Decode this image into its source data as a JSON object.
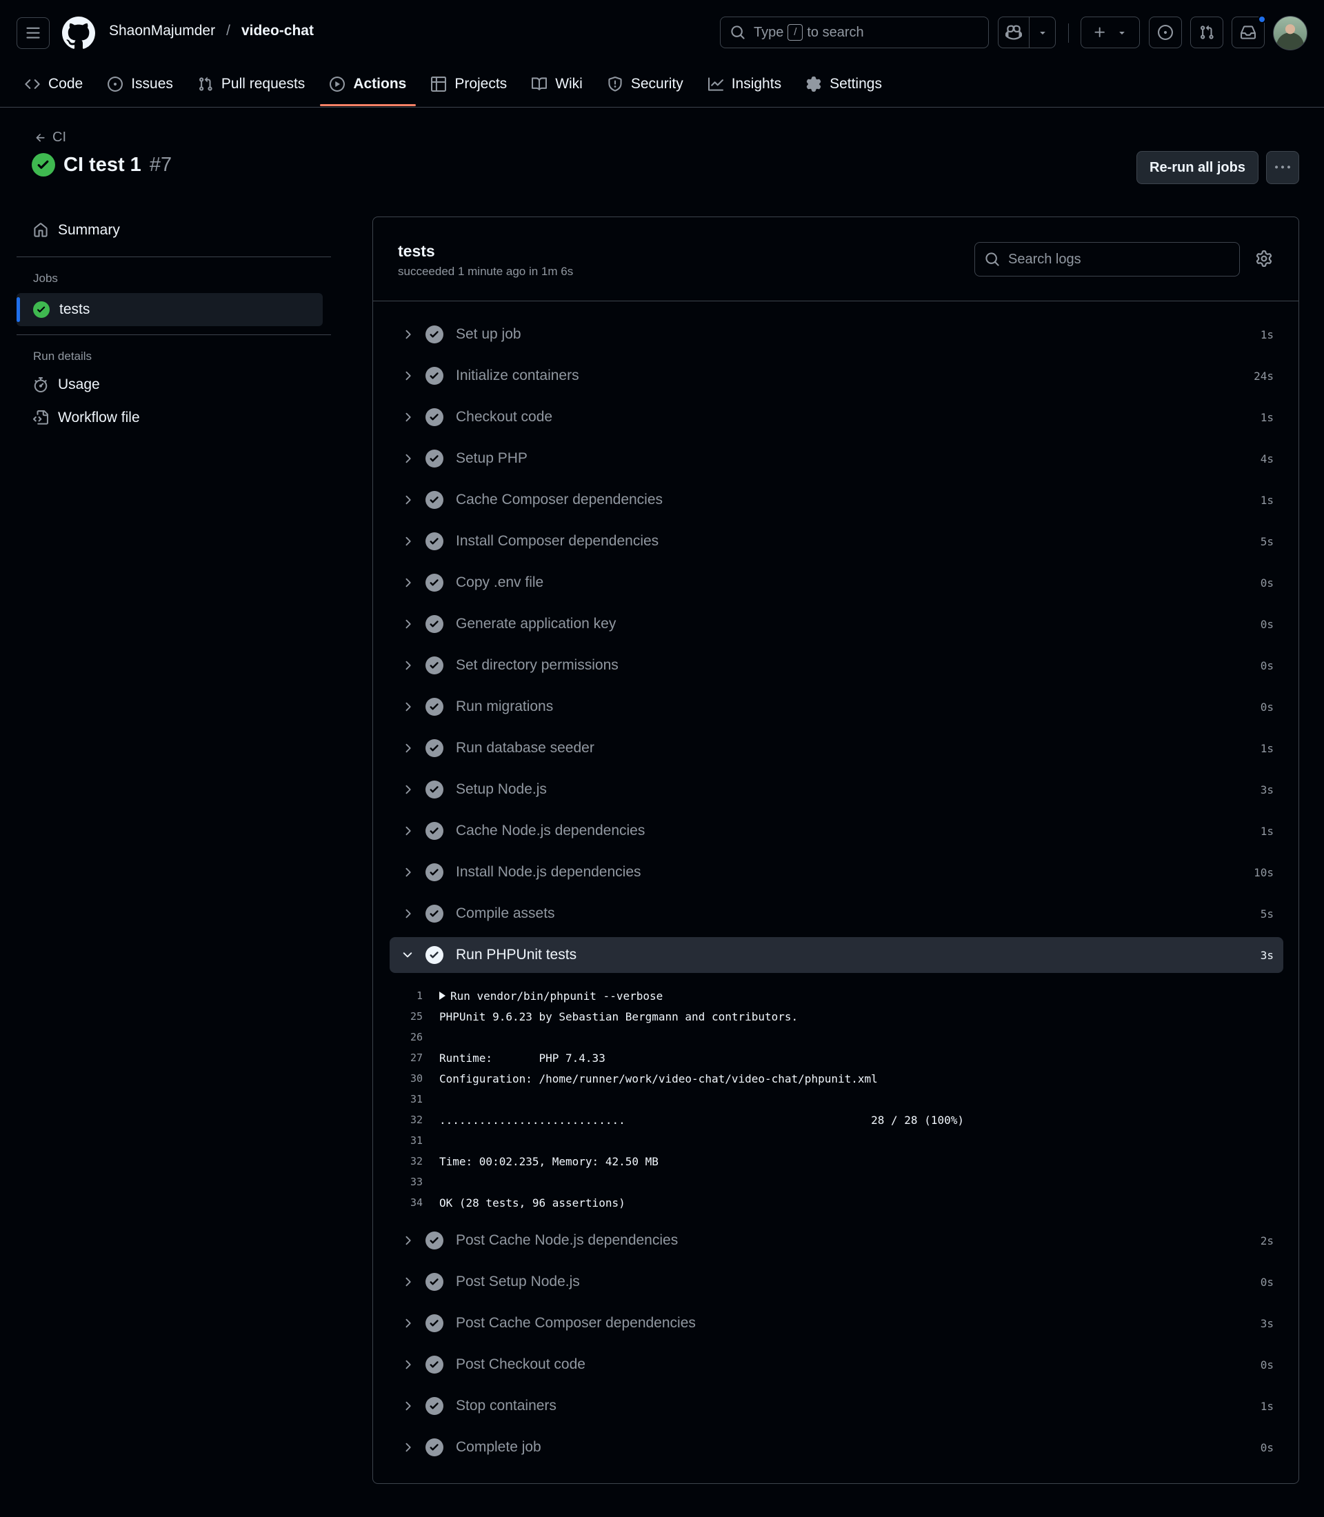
{
  "header": {
    "owner": "ShaonMajumder",
    "separator": "/",
    "repo": "video-chat",
    "search": {
      "prefix": "Type",
      "key": "/",
      "suffix": "to search"
    }
  },
  "tabs": [
    {
      "label": "Code",
      "icon": "code-icon",
      "active": false
    },
    {
      "label": "Issues",
      "icon": "issue-opened-icon",
      "active": false
    },
    {
      "label": "Pull requests",
      "icon": "git-pull-request-icon",
      "active": false
    },
    {
      "label": "Actions",
      "icon": "play-icon",
      "active": true
    },
    {
      "label": "Projects",
      "icon": "table-icon",
      "active": false
    },
    {
      "label": "Wiki",
      "icon": "book-icon",
      "active": false
    },
    {
      "label": "Security",
      "icon": "shield-icon",
      "active": false
    },
    {
      "label": "Insights",
      "icon": "graph-icon",
      "active": false
    },
    {
      "label": "Settings",
      "icon": "gear-icon",
      "active": false
    }
  ],
  "run": {
    "back_label": "CI",
    "title": "CI test 1",
    "number": "#7",
    "rerun_label": "Re-run all jobs"
  },
  "sidebar": {
    "summary_label": "Summary",
    "jobs_heading": "Jobs",
    "job_label": "tests",
    "details_heading": "Run details",
    "usage_label": "Usage",
    "workflow_label": "Workflow file"
  },
  "job": {
    "name": "tests",
    "status": "succeeded 1 minute ago in 1m 6s",
    "search_placeholder": "Search logs"
  },
  "steps_before": [
    {
      "label": "Set up job",
      "duration": "1s"
    },
    {
      "label": "Initialize containers",
      "duration": "24s"
    },
    {
      "label": "Checkout code",
      "duration": "1s"
    },
    {
      "label": "Setup PHP",
      "duration": "4s"
    },
    {
      "label": "Cache Composer dependencies",
      "duration": "1s"
    },
    {
      "label": "Install Composer dependencies",
      "duration": "5s"
    },
    {
      "label": "Copy .env file",
      "duration": "0s"
    },
    {
      "label": "Generate application key",
      "duration": "0s"
    },
    {
      "label": "Set directory permissions",
      "duration": "0s"
    },
    {
      "label": "Run migrations",
      "duration": "0s"
    },
    {
      "label": "Run database seeder",
      "duration": "1s"
    },
    {
      "label": "Setup Node.js",
      "duration": "3s"
    },
    {
      "label": "Cache Node.js dependencies",
      "duration": "1s"
    },
    {
      "label": "Install Node.js dependencies",
      "duration": "10s"
    },
    {
      "label": "Compile assets",
      "duration": "5s"
    }
  ],
  "expanded_step": {
    "label": "Run PHPUnit tests",
    "duration": "3s",
    "log": [
      {
        "ln": "1",
        "text": "Run vendor/bin/phpunit --verbose",
        "collapsible": true
      },
      {
        "ln": "25",
        "text": "PHPUnit 9.6.23 by Sebastian Bergmann and contributors."
      },
      {
        "ln": "26",
        "text": ""
      },
      {
        "ln": "27",
        "text": "Runtime:       PHP 7.4.33"
      },
      {
        "ln": "30",
        "text": "Configuration: /home/runner/work/video-chat/video-chat/phpunit.xml"
      },
      {
        "ln": "31",
        "text": ""
      },
      {
        "ln": "32",
        "text": "............................                                     28 / 28 (100%)"
      },
      {
        "ln": "31",
        "text": ""
      },
      {
        "ln": "32",
        "text": "Time: 00:02.235, Memory: 42.50 MB"
      },
      {
        "ln": "33",
        "text": ""
      },
      {
        "ln": "34",
        "text": "OK (28 tests, 96 assertions)"
      }
    ]
  },
  "steps_after": [
    {
      "label": "Post Cache Node.js dependencies",
      "duration": "2s"
    },
    {
      "label": "Post Setup Node.js",
      "duration": "0s"
    },
    {
      "label": "Post Cache Composer dependencies",
      "duration": "3s"
    },
    {
      "label": "Post Checkout code",
      "duration": "0s"
    },
    {
      "label": "Stop containers",
      "duration": "1s"
    },
    {
      "label": "Complete job",
      "duration": "0s"
    }
  ],
  "colors": {
    "success": "#3fb950",
    "step_check": "#9198a1",
    "accent_underline": "#f78166",
    "selected_bar": "#1f6feb"
  }
}
